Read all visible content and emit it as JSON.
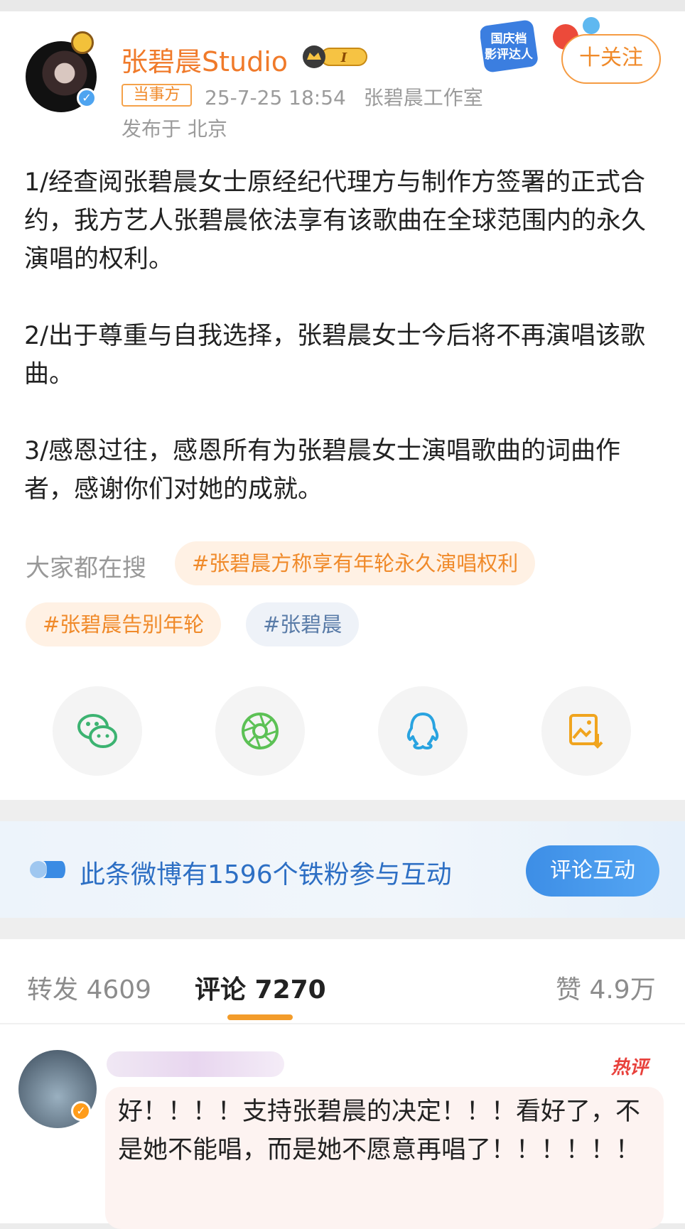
{
  "post": {
    "author_name": "张碧晨Studio",
    "rank_badge": "I",
    "party_tag": "当事方",
    "time": "25-7-25 18:54",
    "source": "张碧晨工作室",
    "location": "发布于 北京",
    "follow_label": "十关注",
    "promo_badge_lines": [
      "国庆档",
      "影评达人"
    ],
    "paragraphs": [
      "1/经查阅张碧晨女士原经纪代理方与制作方签署的正式合约，我方艺人张碧晨依法享有该歌曲在全球范围内的永久演唱的权利。",
      "2/出于尊重与自我选择，张碧晨女士今后将不再演唱该歌曲。",
      "3/感恩过往，感恩所有为张碧晨女士演唱歌曲的词曲作者，感谢你们对她的成就。"
    ]
  },
  "search": {
    "label": "大家都在搜",
    "chips": [
      "#张碧晨方称享有年轮永久演唱权利",
      "#张碧晨告别年轮",
      "#张碧晨"
    ]
  },
  "share": {
    "icons": [
      "wechat-icon",
      "moments-icon",
      "qq-icon",
      "save-image-icon"
    ]
  },
  "fans": {
    "text": "此条微博有1596个铁粉参与互动",
    "button": "评论互动"
  },
  "tabs": {
    "repost": "转发 4609",
    "comments": "评论 7270",
    "likes": "赞 4.9万"
  },
  "comment": {
    "hot_badge": "热评",
    "text": "好！！！！支持张碧晨的决定！！！看好了，不是她不能唱，而是她不愿意再唱了！！！！！！"
  },
  "colors": {
    "accent_orange": "#f08a2a",
    "link_blue": "#2d6fc4",
    "hot_red": "#e8413c"
  }
}
